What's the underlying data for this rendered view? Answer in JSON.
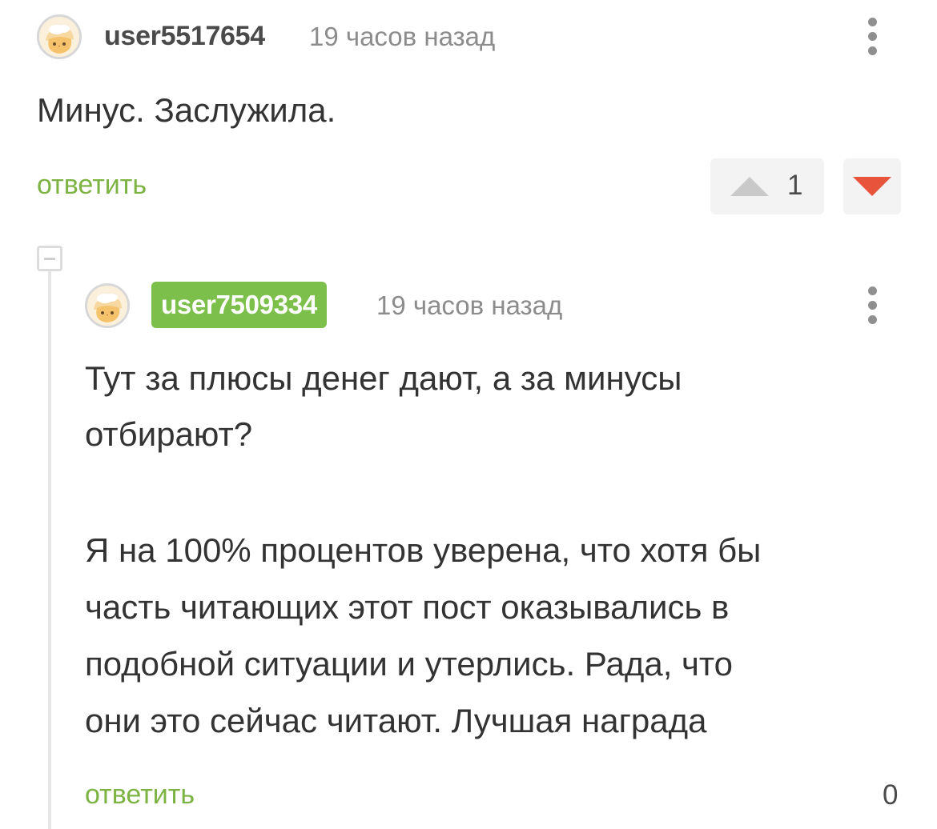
{
  "comments": [
    {
      "username": "user5517654",
      "timestamp": "19 часов назад",
      "text": "Минус. Заслужила.",
      "reply_label": "ответить",
      "rating": "1",
      "avatar_icon": "cat-avatar-icon",
      "more_icon": "vertical-dots-icon",
      "upvote_icon": "triangle-up-icon",
      "downvote_icon": "triangle-down-icon",
      "upvote_color": "#c9c9c9",
      "downvote_color": "#e8533b"
    },
    {
      "username": "user7509334",
      "username_badge_color": "#7cbf4a",
      "timestamp": "19 часов назад",
      "paragraphs": [
        "Тут за плюсы денег дают, а за минусы",
        "отбирают?",
        "Я на 100% процентов уверена, что хотя бы",
        "часть читающих этот пост оказывались в",
        "подобной ситуации и утерлись. Рада, что",
        "они это сейчас читают. Лучшая награда"
      ],
      "reply_label": "ответить",
      "rating": "0",
      "avatar_icon": "cat-avatar-icon",
      "more_icon": "vertical-dots-icon",
      "collapse_icon": "collapse-thread-icon"
    }
  ],
  "accent_color": "#7cb342"
}
